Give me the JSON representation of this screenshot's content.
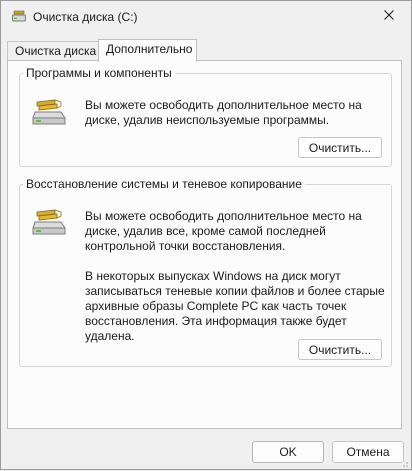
{
  "window": {
    "title": "Очистка диска  (C:)",
    "close_icon": "close-icon"
  },
  "tabs": [
    {
      "label": "Очистка диска",
      "selected": false
    },
    {
      "label": "Дополнительно",
      "selected": true
    }
  ],
  "groups": {
    "programs": {
      "title": "Программы и компоненты",
      "icon": "drive-cleanup-icon",
      "description": "Вы можете освободить дополнительное место на диске, удалив неиспользуемые программы.",
      "button_label": "Очистить..."
    },
    "restore": {
      "title": "Восстановление системы и теневое копирование",
      "icon": "drive-cleanup-icon",
      "description": "Вы можете освободить дополнительное место на диске, удалив все, кроме самой последней контрольной точки восстановления.",
      "description_2": "В некоторых выпусках Windows на диск могут записываться теневые копии файлов и более старые архивные образы Complete PC как часть точек восстановления. Эта информация также будет удалена.",
      "button_label": "Очистить..."
    }
  },
  "footer": {
    "ok_label": "OK",
    "cancel_label": "Отмена"
  },
  "colors": {
    "window_bg": "#f0f0f0",
    "panel_bg": "#fcfcfc",
    "border": "#bfbfbf"
  }
}
